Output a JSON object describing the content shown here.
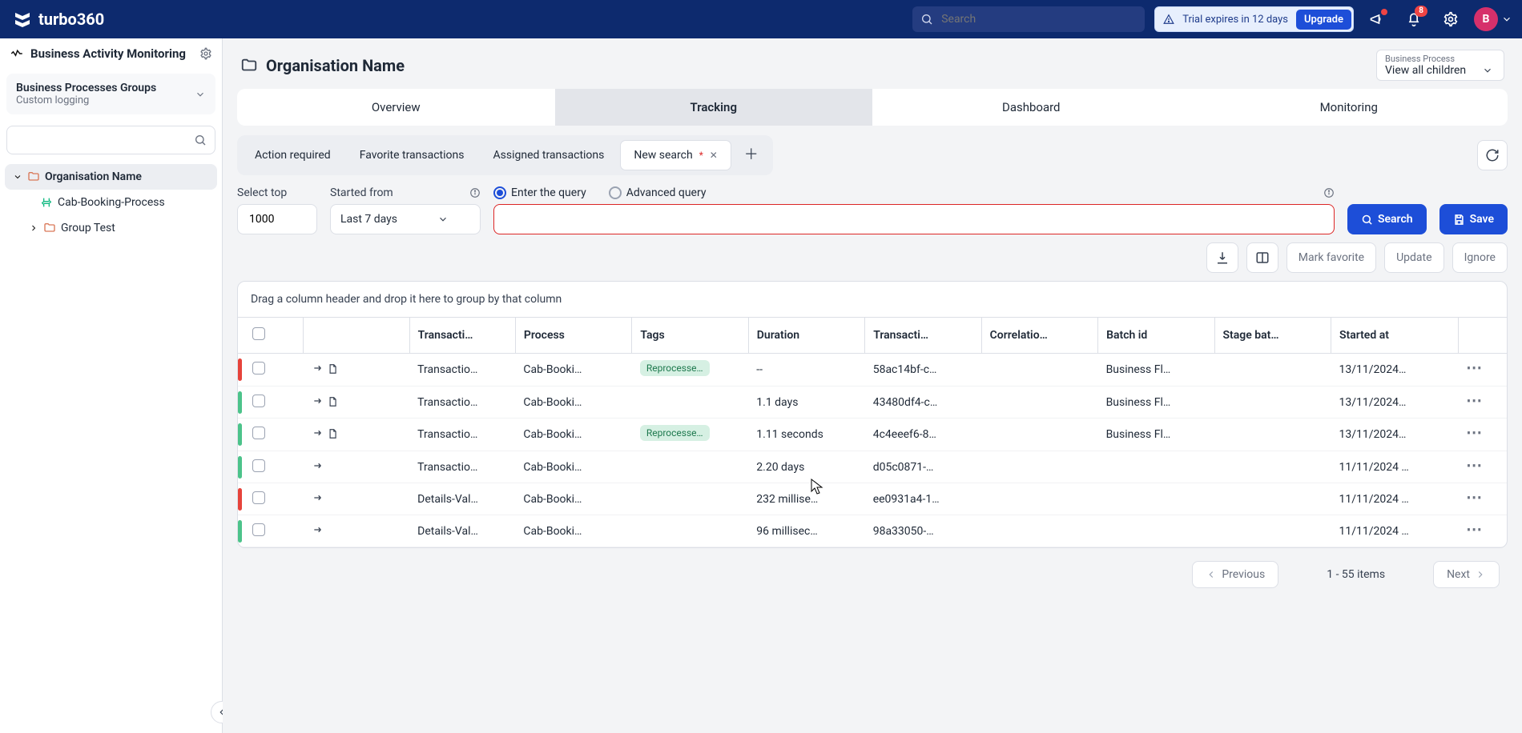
{
  "topbar": {
    "brand": "turbo360",
    "search_placeholder": "Search",
    "trial_text": "Trial expires in 12 days",
    "upgrade": "Upgrade",
    "notif_count": "8",
    "avatar_letter": "B"
  },
  "sidebar": {
    "title": "Business Activity Monitoring",
    "group_title": "Business Processes Groups",
    "group_sub": "Custom logging",
    "tree": {
      "org": "Organisation Name",
      "child1": "Cab-Booking-Process",
      "child2": "Group Test"
    }
  },
  "page": {
    "title": "Organisation Name",
    "bp_label": "Business Process",
    "bp_value": "View all children"
  },
  "tabs": {
    "overview": "Overview",
    "tracking": "Tracking",
    "dashboard": "Dashboard",
    "monitoring": "Monitoring"
  },
  "subtabs": {
    "action": "Action required",
    "favorite": "Favorite transactions",
    "assigned": "Assigned transactions",
    "newsearch": "New search"
  },
  "query": {
    "select_top_label": "Select top",
    "select_top_value": "1000",
    "started_label": "Started from",
    "started_value": "Last 7 days",
    "radio_enter": "Enter the query",
    "radio_adv": "Advanced query",
    "search_btn": "Search",
    "save_btn": "Save"
  },
  "actions": {
    "mark_fav": "Mark favorite",
    "update": "Update",
    "ignore": "Ignore"
  },
  "grid": {
    "group_hint": "Drag a column header and drop it here to group by that column",
    "cols": {
      "trans": "Transacti…",
      "process": "Process",
      "tags": "Tags",
      "duration": "Duration",
      "tid": "Transacti…",
      "corr": "Correlatio…",
      "batch": "Batch id",
      "stage": "Stage bat…",
      "started": "Started at"
    },
    "rows": [
      {
        "status": "r",
        "doc": true,
        "trans": "Transactio…",
        "process": "Cab-Booki…",
        "tag": "Reprocesse…",
        "duration": "--",
        "tid": "58ac14bf-c…",
        "batch": "Business Fl…",
        "started": "13/11/2024…"
      },
      {
        "status": "g",
        "doc": true,
        "trans": "Transactio…",
        "process": "Cab-Booki…",
        "tag": "",
        "duration": "1.1 days",
        "tid": "43480df4-c…",
        "batch": "Business Fl…",
        "started": "13/11/2024…"
      },
      {
        "status": "g",
        "doc": true,
        "trans": "Transactio…",
        "process": "Cab-Booki…",
        "tag": "Reprocesse…",
        "duration": "1.11 seconds",
        "tid": "4c4eeef6-8…",
        "batch": "Business Fl…",
        "started": "13/11/2024…"
      },
      {
        "status": "g",
        "doc": false,
        "trans": "Transactio…",
        "process": "Cab-Booki…",
        "tag": "",
        "duration": "2.20 days",
        "tid": "d05c0871-…",
        "batch": "",
        "started": "11/11/2024 …"
      },
      {
        "status": "r",
        "doc": false,
        "trans": "Details-Val…",
        "process": "Cab-Booki…",
        "tag": "",
        "duration": "232 millise…",
        "tid": "ee0931a4-1…",
        "batch": "",
        "started": "11/11/2024 …"
      },
      {
        "status": "g",
        "doc": false,
        "trans": "Details-Val…",
        "process": "Cab-Booki…",
        "tag": "",
        "duration": "96 millisec…",
        "tid": "98a33050-…",
        "batch": "",
        "started": "11/11/2024 …"
      }
    ]
  },
  "pager": {
    "prev": "Previous",
    "info": "1 - 55 items",
    "next": "Next"
  }
}
